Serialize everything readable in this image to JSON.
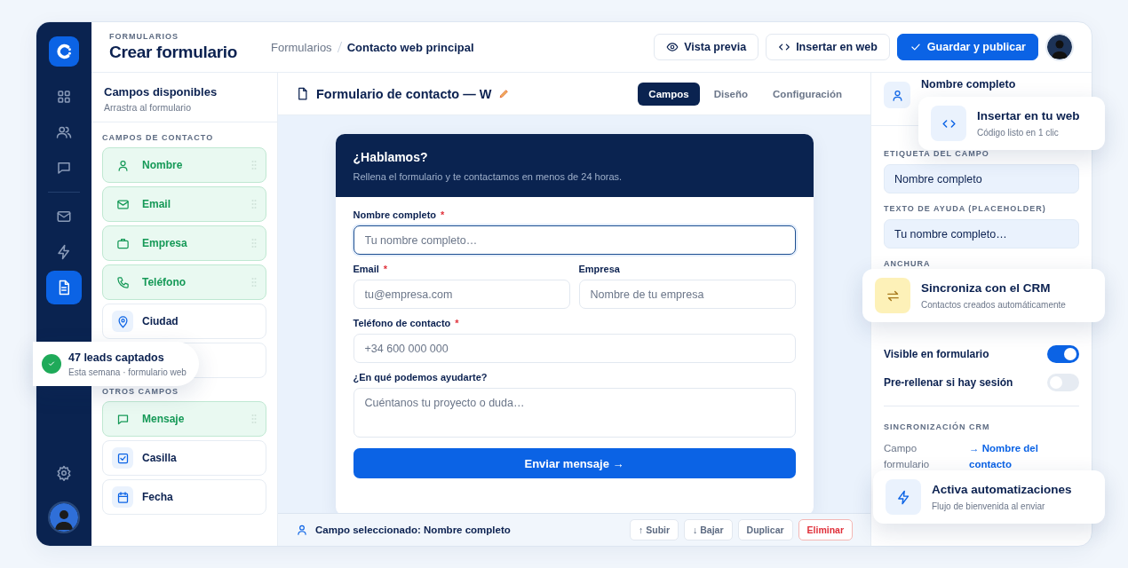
{
  "rail": {
    "items": [
      {
        "kind": "grid",
        "selected": false
      },
      {
        "kind": "users",
        "selected": false
      },
      {
        "kind": "chat",
        "selected": false
      },
      {
        "kind": "mail",
        "selected": false
      },
      {
        "kind": "bolt",
        "selected": false
      },
      {
        "kind": "doc",
        "selected": true
      }
    ],
    "bottom": [
      {
        "kind": "gear",
        "selected": false
      }
    ]
  },
  "header": {
    "eyebrow": "FORMULARIOS",
    "title": "Crear formulario",
    "breadcrumb": [
      "Formularios",
      "Contacto web principal"
    ],
    "buttons": [
      {
        "label": "Vista previa",
        "kind": "preview"
      },
      {
        "label": "Insertar en web",
        "kind": "embed"
      },
      {
        "label": "Guardar y publicar",
        "kind": "publish"
      }
    ]
  },
  "fields_panel": {
    "title": "Campos disponibles",
    "subtitle": "Arrastra al formulario",
    "groups": [
      {
        "heading": "CAMPOS DE CONTACTO",
        "items": [
          {
            "label": "Nombre",
            "kind": "person",
            "added": true
          },
          {
            "label": "Email",
            "kind": "mail",
            "added": true
          },
          {
            "label": "Empresa",
            "kind": "briefcase",
            "added": true
          },
          {
            "label": "Teléfono",
            "kind": "phone",
            "added": true
          },
          {
            "label": "Ciudad",
            "kind": "pin",
            "added": false
          },
          {
            "kind": "blank",
            "added": false
          }
        ]
      },
      {
        "heading": "OTROS CAMPOS",
        "items": [
          {
            "label": "Mensaje",
            "kind": "chat",
            "added": true
          },
          {
            "label": "Casilla",
            "kind": "checkbox",
            "added": false
          },
          {
            "label": "Fecha",
            "kind": "calendar",
            "added": false
          }
        ]
      }
    ]
  },
  "editor": {
    "title": "Formulario de contacto — W",
    "tabs": [
      {
        "label": "Campos",
        "selected": true
      },
      {
        "label": "Diseño",
        "selected": false
      },
      {
        "label": "Configuración",
        "selected": false
      }
    ]
  },
  "form": {
    "heading": "¿Hablamos?",
    "intro": "Rellena el formulario y te contactamos en menos de 24 horas.",
    "fields": [
      {
        "label": "Nombre completo",
        "asterisk": "*",
        "placeholder": "Tu nombre completo…",
        "kind": "input",
        "focused": true
      },
      {
        "label": "Email",
        "asterisk": "*",
        "placeholder": "tu@empresa.com",
        "kind": "input_half",
        "focused": false
      },
      {
        "label": "Empresa",
        "placeholder": "Nombre de tu empresa",
        "kind": "input_half",
        "focused": false
      },
      {
        "label": "Teléfono de contacto",
        "asterisk": "*",
        "placeholder": "+34 600 000 000",
        "kind": "input",
        "focused": false
      },
      {
        "label": "¿En qué podemos ayudarte?",
        "placeholder": "Cuéntanos tu proyecto o duda…",
        "kind": "textarea",
        "focused": false
      }
    ],
    "submit": "Enviar mensaje →"
  },
  "status_bar": {
    "text": "Campo seleccionado: Nombre completo",
    "buttons": [
      {
        "label": "↑ Subir",
        "kind": "normal"
      },
      {
        "label": "↓ Bajar",
        "kind": "normal"
      },
      {
        "label": "Duplicar",
        "kind": "normal"
      },
      {
        "label": "Eliminar",
        "kind": "danger"
      }
    ]
  },
  "properties": {
    "title": "Nombre completo",
    "label_heading": "ETIQUETA DEL CAMPO",
    "label_value": "Nombre completo",
    "help_heading": "TEXTO DE AYUDA (PLACEHOLDER)",
    "help_value": "Tu nombre completo…",
    "width_heading": "ANCHURA",
    "toggles": [
      {
        "label": "Visible en formulario",
        "on": true
      },
      {
        "label": "Pre-rellenar si hay sesión",
        "on": false
      }
    ],
    "crm_heading": "SINCRONIZACIÓN CRM",
    "crm_field": "Campo formulario",
    "crm_target": "→ Nombre del contacto"
  },
  "toasts": [
    {
      "kind": "leads",
      "title": "47 leads captados",
      "subtitle": "Esta semana · formulario web"
    },
    {
      "kind": "embed",
      "title": "Insertar en tu web",
      "subtitle": "Código listo en 1 clic"
    },
    {
      "kind": "sync",
      "title": "Sincroniza con el CRM",
      "subtitle": "Contactos creados automáticamente"
    },
    {
      "kind": "automation",
      "title": "Activa automatizaciones",
      "subtitle": "Flujo de bienvenida al enviar"
    }
  ]
}
